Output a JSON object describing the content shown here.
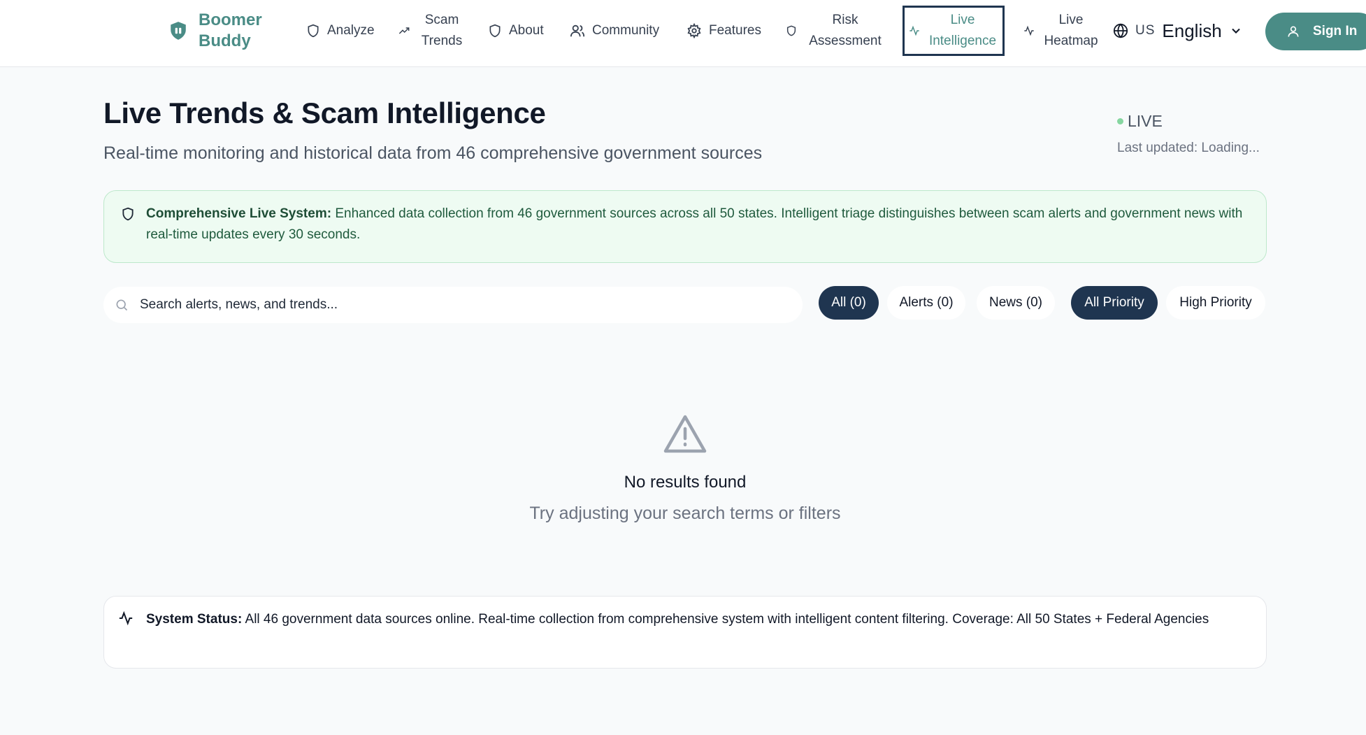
{
  "app": {
    "brand_line1": "Boomer",
    "brand_line2": "Buddy",
    "accent_color": "#4a8c86",
    "navy_color": "#1f3550"
  },
  "nav": {
    "items": [
      {
        "label": "Analyze",
        "icon": "shield-icon"
      },
      {
        "label": "Scam Trends",
        "icon": "trending-up-icon"
      },
      {
        "label": "About",
        "icon": "shield-icon"
      },
      {
        "label": "Community",
        "icon": "users-icon"
      },
      {
        "label": "Features",
        "icon": "gear-icon"
      },
      {
        "label": "Risk Assessment",
        "icon": "shield-icon"
      },
      {
        "label": "Live Intelligence",
        "icon": "activity-icon",
        "active": true
      },
      {
        "label": "Live Heatmap",
        "icon": "activity-icon"
      }
    ]
  },
  "language": {
    "code": "US",
    "name": "English",
    "icon": "globe-icon"
  },
  "signin": {
    "label": "Sign In",
    "icon": "user-icon"
  },
  "page": {
    "title": "Live Trends & Scam Intelligence",
    "subtitle": "Real-time monitoring and historical data from 46 comprehensive government sources",
    "live_label": "LIVE",
    "last_updated": "Last updated: Loading..."
  },
  "banner": {
    "title": "Comprehensive Live System:",
    "text": "Enhanced data collection from 46 government sources across all 50 states. Intelligent triage distinguishes between scam alerts and government news with real-time updates every 30 seconds."
  },
  "search": {
    "placeholder": "Search alerts, news, and trends...",
    "value": ""
  },
  "filters": {
    "type": [
      {
        "label": "All (0)",
        "selected": true
      },
      {
        "label": "Alerts (0)",
        "selected": false
      },
      {
        "label": "News (0)",
        "selected": false
      }
    ],
    "priority": [
      {
        "label": "All Priority",
        "selected": true
      },
      {
        "label": "High Priority",
        "selected": false
      }
    ]
  },
  "empty": {
    "title": "No results found",
    "subtitle": "Try adjusting your search terms or filters",
    "icon": "warning-triangle-icon"
  },
  "status": {
    "title": "System Status:",
    "text": "All 46 government data sources online. Real-time collection from comprehensive system with intelligent content filtering. Coverage: All 50 States + Federal Agencies"
  }
}
